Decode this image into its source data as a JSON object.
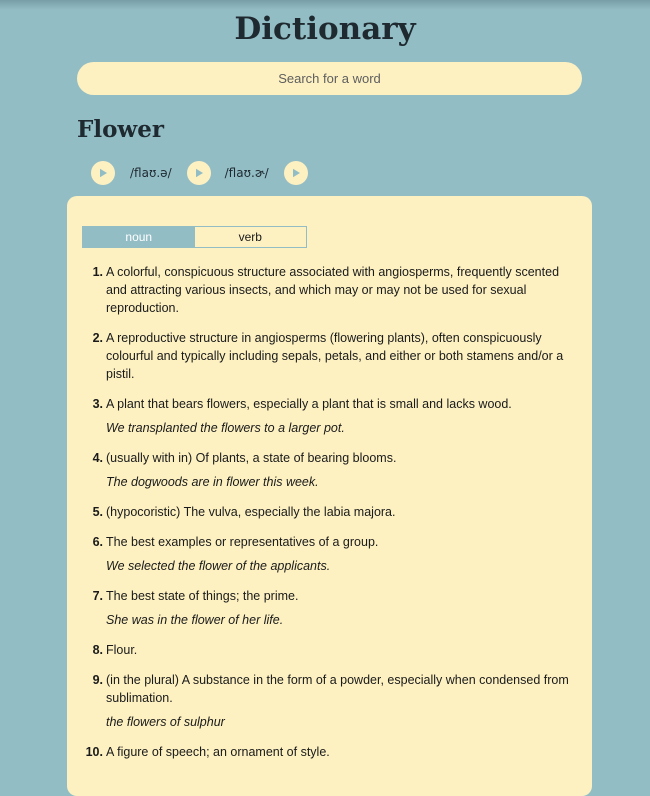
{
  "app": {
    "title": "Dictionary"
  },
  "search": {
    "placeholder": "Search for a word",
    "value": ""
  },
  "word": {
    "title": "Flower",
    "phonetics": [
      "/flaʊ.ə/",
      "/flaʊ.ɚ/"
    ]
  },
  "tabs": [
    {
      "label": "noun",
      "active": true
    },
    {
      "label": "verb",
      "active": false
    }
  ],
  "definitions": [
    {
      "num": "1.",
      "text": "A colorful, conspicuous structure associated with angiosperms, frequently scented and attracting various insects, and which may or may not be used for sexual reproduction.",
      "example": ""
    },
    {
      "num": "2.",
      "text": "A reproductive structure in angiosperms (flowering plants), often conspicuously colourful and typically including sepals, petals, and either or both stamens and/or a pistil.",
      "example": ""
    },
    {
      "num": "3.",
      "text": "A plant that bears flowers, especially a plant that is small and lacks wood.",
      "example": "We transplanted the flowers to a larger pot."
    },
    {
      "num": "4.",
      "text": "(usually with in) Of plants, a state of bearing blooms.",
      "example": "The dogwoods are in flower this week."
    },
    {
      "num": "5.",
      "text": "(hypocoristic) The vulva, especially the labia majora.",
      "example": ""
    },
    {
      "num": "6.",
      "text": "The best examples or representatives of a group.",
      "example": "We selected the flower of the applicants."
    },
    {
      "num": "7.",
      "text": "The best state of things; the prime.",
      "example": "She was in the flower of her life."
    },
    {
      "num": "8.",
      "text": "Flour.",
      "example": ""
    },
    {
      "num": "9.",
      "text": "(in the plural) A substance in the form of a powder, especially when condensed from sublimation.",
      "example": "the flowers of sulphur"
    },
    {
      "num": "10.",
      "text": "A figure of speech; an ornament of style.",
      "example": ""
    }
  ],
  "colors": {
    "background": "#93bdc5",
    "panel": "#fdf1c2",
    "heading": "#1f2a30"
  },
  "icons": {
    "audio_button": "play-icon"
  }
}
